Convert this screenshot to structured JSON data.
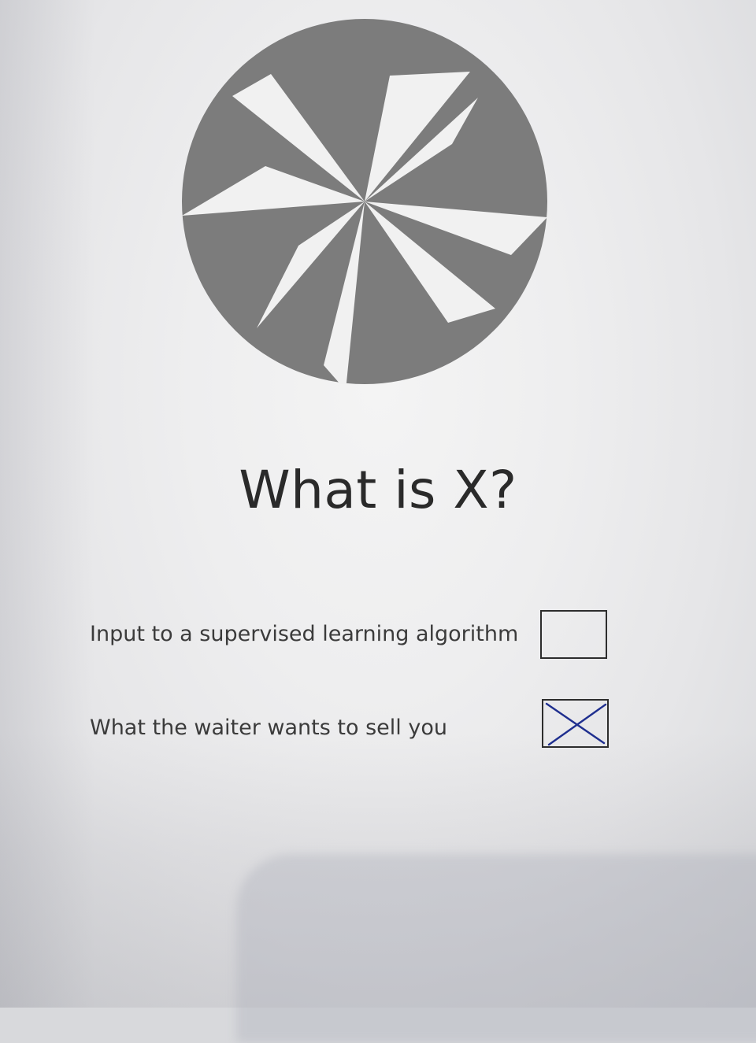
{
  "question": {
    "title": "What is X?"
  },
  "options": [
    {
      "label": "Input to a supervised learning algorithm",
      "checked": false
    },
    {
      "label": "What the waiter wants to sell you",
      "checked": true
    }
  ],
  "colors": {
    "logo": "#7c7c7c",
    "text": "#2a2a2a",
    "checkmark": "#1f2f8f"
  },
  "icons": {
    "logo": "pinwheel-star-logo",
    "check": "x-mark-icon"
  }
}
